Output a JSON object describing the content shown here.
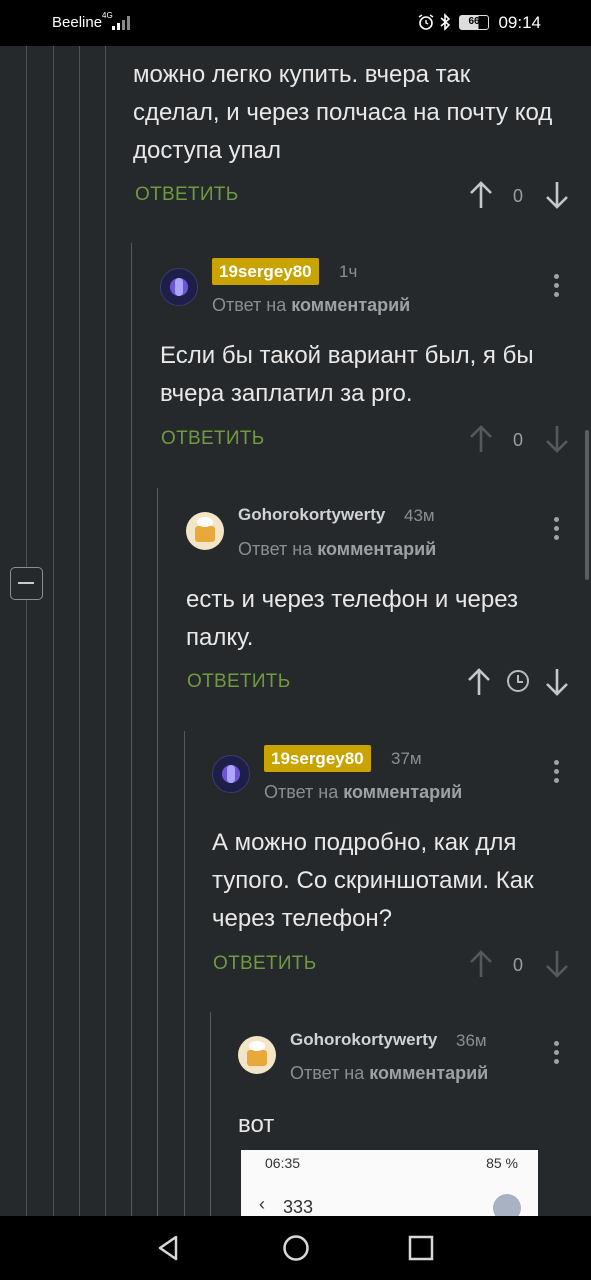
{
  "status_bar": {
    "carrier": "Beeline",
    "network": "4G",
    "battery": "66",
    "time": "09:14"
  },
  "comments": [
    {
      "text": "можно легко купить. вчера так сделал, и через полчаса на почту код доступа упал",
      "reply_label": "ОТВЕТИТЬ",
      "score": "0"
    },
    {
      "user": "19sergey80",
      "time": "1ч",
      "reply_prefix": "Ответ на",
      "reply_target": "комментарий",
      "text": "Если бы такой вариант был, я бы вчера заплатил за pro.",
      "reply_label": "ОТВЕТИТЬ",
      "score": "0"
    },
    {
      "user": "Gohorokortywerty",
      "time": "43м",
      "reply_prefix": "Ответ на",
      "reply_target": "комментарий",
      "text": "есть и через телефон и через палку.",
      "reply_label": "ОТВЕТИТЬ"
    },
    {
      "user": "19sergey80",
      "time": "37м",
      "reply_prefix": "Ответ на",
      "reply_target": "комментарий",
      "text": "А можно подробно, как для тупого. Со скриншотами. Как через телефон?",
      "reply_label": "ОТВЕТИТЬ",
      "score": "0"
    },
    {
      "user": "Gohorokortywerty",
      "time": "36м",
      "reply_prefix": "Ответ на",
      "reply_target": "комментарий",
      "text": "вот"
    }
  ],
  "embedded_screenshot": {
    "time": "06:35",
    "battery": "85 %",
    "title": "333"
  },
  "colors": {
    "background": "#26292c",
    "accent_green": "#6f9a3e",
    "badge_gold": "#c9a300"
  }
}
